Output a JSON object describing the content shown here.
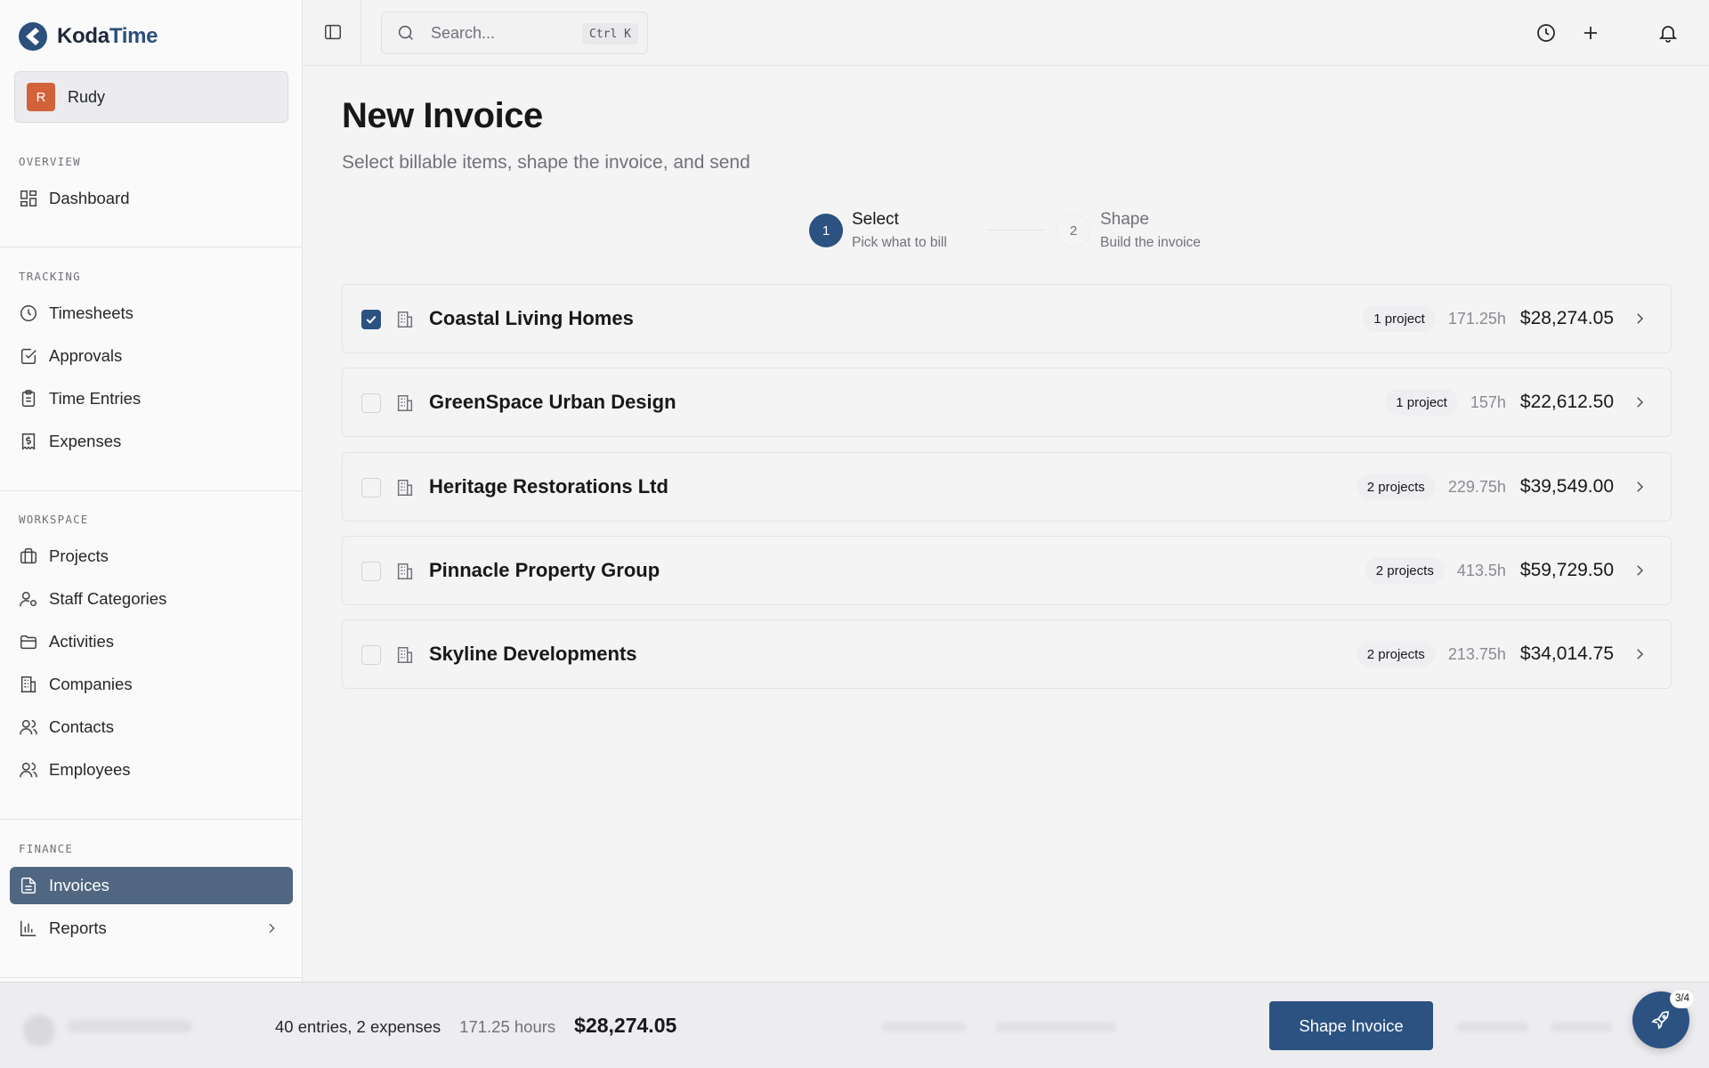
{
  "brand": {
    "name_part1": "Koda",
    "name_part2": "Time"
  },
  "user": {
    "initial": "R",
    "name": "Rudy"
  },
  "sidebar": {
    "sections": [
      {
        "label": "OVERVIEW",
        "items": [
          {
            "label": "Dashboard",
            "icon": "dashboard-icon"
          }
        ]
      },
      {
        "label": "TRACKING",
        "items": [
          {
            "label": "Timesheets",
            "icon": "clock-icon"
          },
          {
            "label": "Approvals",
            "icon": "check-square-icon"
          },
          {
            "label": "Time Entries",
            "icon": "clipboard-icon"
          },
          {
            "label": "Expenses",
            "icon": "receipt-icon"
          }
        ]
      },
      {
        "label": "WORKSPACE",
        "items": [
          {
            "label": "Projects",
            "icon": "briefcase-icon"
          },
          {
            "label": "Staff Categories",
            "icon": "user-gear-icon"
          },
          {
            "label": "Activities",
            "icon": "folder-icon"
          },
          {
            "label": "Companies",
            "icon": "building-icon"
          },
          {
            "label": "Contacts",
            "icon": "users-icon"
          },
          {
            "label": "Employees",
            "icon": "users-icon"
          }
        ]
      },
      {
        "label": "FINANCE",
        "items": [
          {
            "label": "Invoices",
            "icon": "document-icon",
            "active": true
          },
          {
            "label": "Reports",
            "icon": "bar-chart-icon"
          }
        ]
      }
    ]
  },
  "topbar": {
    "search_placeholder": "Search...",
    "search_shortcut": "Ctrl K"
  },
  "page": {
    "title": "New Invoice",
    "subtitle": "Select billable items, shape the invoice, and send"
  },
  "stepper": {
    "steps": [
      {
        "number": "1",
        "title": "Select",
        "description": "Pick what to bill",
        "active": true
      },
      {
        "number": "2",
        "title": "Shape",
        "description": "Build the invoice",
        "active": false
      }
    ]
  },
  "companies": [
    {
      "name": "Coastal Living Homes",
      "projects": "1 project",
      "hours": "171.25h",
      "amount": "$28,274.05",
      "checked": true
    },
    {
      "name": "GreenSpace Urban Design",
      "projects": "1 project",
      "hours": "157h",
      "amount": "$22,612.50",
      "checked": false
    },
    {
      "name": "Heritage Restorations Ltd",
      "projects": "2 projects",
      "hours": "229.75h",
      "amount": "$39,549.00",
      "checked": false
    },
    {
      "name": "Pinnacle Property Group",
      "projects": "2 projects",
      "hours": "413.5h",
      "amount": "$59,729.50",
      "checked": false
    },
    {
      "name": "Skyline Developments",
      "projects": "2 projects",
      "hours": "213.75h",
      "amount": "$34,014.75",
      "checked": false
    }
  ],
  "footer": {
    "entries": "40 entries, 2 expenses",
    "hours": "171.25 hours",
    "total": "$28,274.05",
    "button": "Shape Invoice",
    "fab_badge": "3/4"
  },
  "colors": {
    "primary": "#2c5282",
    "active_nav": "#506681",
    "avatar": "#d2623a"
  }
}
